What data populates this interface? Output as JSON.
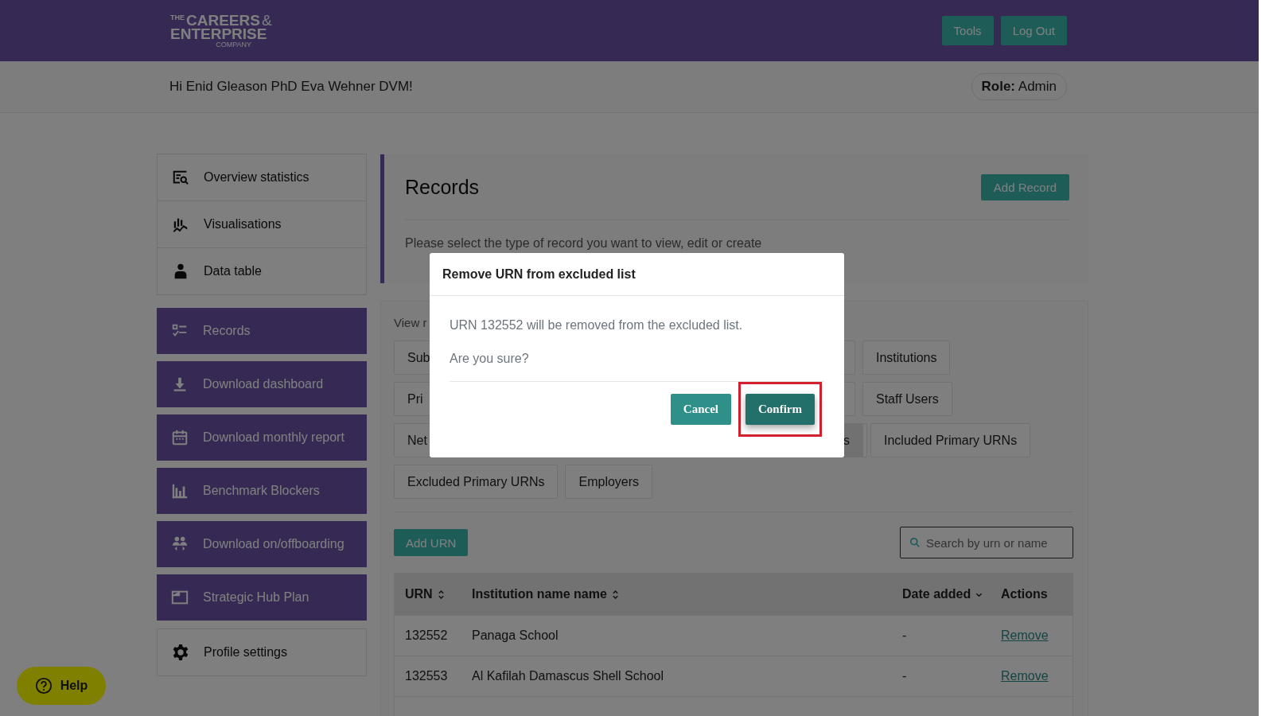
{
  "header": {
    "logo": {
      "small": "THE",
      "line1": "CAREERS",
      "amp": "&",
      "line2": "ENTERPRISE",
      "line3": "COMPANY"
    },
    "buttons": [
      "Tools",
      "Log Out"
    ]
  },
  "greeting": "Hi Enid Gleason PhD Eva Wehner DVM!",
  "role": {
    "label": "Role:",
    "value": "Admin"
  },
  "sidebar": {
    "items": [
      {
        "label": "Overview statistics",
        "kind": "light"
      },
      {
        "label": "Visualisations",
        "kind": "light"
      },
      {
        "label": "Data table",
        "kind": "light"
      },
      {
        "label": "Records",
        "kind": "dark"
      },
      {
        "label": "Download dashboard",
        "kind": "dark"
      },
      {
        "label": "Download monthly report",
        "kind": "dark"
      },
      {
        "label": "Benchmark Blockers",
        "kind": "dark"
      },
      {
        "label": "Download on/offboarding",
        "kind": "dark"
      },
      {
        "label": "Strategic Hub Plan",
        "kind": "dark"
      },
      {
        "label": "Profile settings",
        "kind": "light"
      }
    ]
  },
  "records": {
    "title": "Records",
    "add_button": "Add Record",
    "description": "Please select the type of record you want to view, edit or create"
  },
  "view": {
    "label": "View r",
    "tab_rows": [
      [
        {
          "label": "Sub",
          "selected": false,
          "kind": "partial"
        },
        {
          "label": "Institutions",
          "selected": false,
          "kind": "full"
        }
      ],
      [
        {
          "label": "Pri",
          "selected": false,
          "kind": "partial"
        },
        {
          "label": "Staff Users",
          "selected": false,
          "kind": "full"
        }
      ],
      [
        {
          "label": "Net",
          "selected": false,
          "kind": "partial"
        },
        {
          "label": "s",
          "selected": true,
          "kind": "tail"
        },
        {
          "label": "Included Primary URNs",
          "selected": false,
          "kind": "full"
        }
      ],
      [
        {
          "label": "Excluded Primary URNs",
          "selected": false,
          "kind": "full"
        },
        {
          "label": "Employers",
          "selected": false,
          "kind": "full"
        }
      ]
    ]
  },
  "table": {
    "add_button": "Add URN",
    "search": {
      "placeholder": "Search by urn or name"
    },
    "columns": [
      {
        "label": "URN",
        "kind": "sortable"
      },
      {
        "label": "Institution name name",
        "kind": "sortable"
      },
      {
        "label": "Date added",
        "kind": "sorted"
      },
      {
        "label": "Actions",
        "kind": "plain"
      }
    ],
    "rows": [
      {
        "urn": "132552",
        "name": "Panaga School",
        "date": "-",
        "action": "Remove"
      },
      {
        "urn": "132553",
        "name": "Al Kafilah Damascus Shell School",
        "date": "-",
        "action": "Remove"
      }
    ]
  },
  "help": "Help",
  "modal": {
    "title": "Remove URN from excluded list",
    "message": "URN 132552 will be removed from the excluded list.",
    "question": "Are you sure?",
    "buttons": [
      {
        "label": "Cancel",
        "kind": "secondary",
        "highlighted": false
      },
      {
        "label": "Confirm",
        "kind": "primary",
        "highlighted": true
      }
    ]
  }
}
